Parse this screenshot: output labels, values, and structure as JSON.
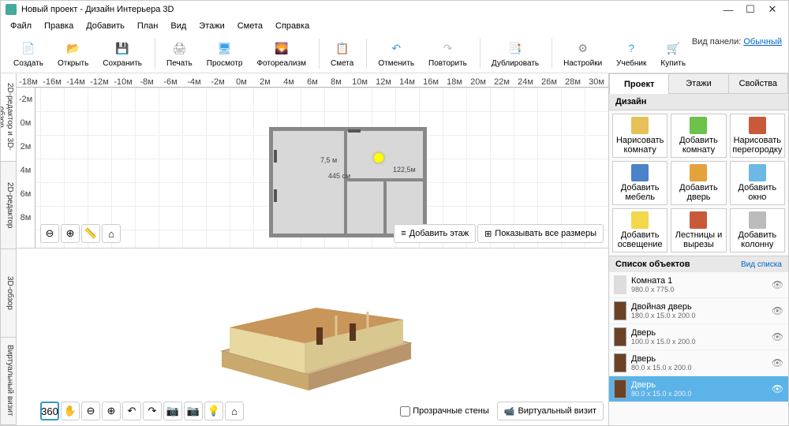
{
  "title": "Новый проект - Дизайн Интерьера 3D",
  "menus": [
    "Файл",
    "Правка",
    "Добавить",
    "План",
    "Вид",
    "Этажи",
    "Смета",
    "Справка"
  ],
  "panel_mode": {
    "label": "Вид панели:",
    "value": "Обычный"
  },
  "toolbar": [
    {
      "label": "Создать",
      "color": "#fff",
      "glyph": "📄"
    },
    {
      "label": "Открыть",
      "color": "#f5c04a",
      "glyph": "📂"
    },
    {
      "label": "Сохранить",
      "color": "#3b6fd1",
      "glyph": "💾"
    },
    {
      "sep": true
    },
    {
      "label": "Печать",
      "color": "#888",
      "glyph": "🖨"
    },
    {
      "label": "Просмотр",
      "color": "#3ba0e6",
      "glyph": "🖥"
    },
    {
      "label": "Фотореализм",
      "color": "#e08a3a",
      "glyph": "🌄"
    },
    {
      "sep": true
    },
    {
      "label": "Смета",
      "color": "#e08a3a",
      "glyph": "📋"
    },
    {
      "sep": true
    },
    {
      "label": "Отменить",
      "color": "#3ba0e6",
      "glyph": "↶"
    },
    {
      "label": "Повторить",
      "color": "#bbb",
      "glyph": "↷"
    },
    {
      "sep": true
    },
    {
      "label": "Дублировать",
      "color": "#3ba0e6",
      "glyph": "📑"
    },
    {
      "sep": true
    },
    {
      "label": "Настройки",
      "color": "#888",
      "glyph": "⚙"
    },
    {
      "label": "Учебник",
      "color": "#3ba0e6",
      "glyph": "?"
    },
    {
      "label": "Купить",
      "color": "#f5b400",
      "glyph": "🛒"
    }
  ],
  "left_tabs": [
    "2D-редактор и 3D-обзор",
    "2D-редактор",
    "3D-обзор",
    "Виртуальный визит"
  ],
  "ruler_h": [
    "-18м",
    "-16м",
    "-14м",
    "-12м",
    "-10м",
    "-8м",
    "-6м",
    "-4м",
    "-2м",
    "0м",
    "2м",
    "4м",
    "6м",
    "8м",
    "10м",
    "12м",
    "14м",
    "16м",
    "18м",
    "20м",
    "22м",
    "24м",
    "26м",
    "28м",
    "30м"
  ],
  "ruler_v": [
    "-2м",
    "0м",
    "2м",
    "4м",
    "6м",
    "8м"
  ],
  "plan_dims": {
    "d1": "7,5 м",
    "d2": "445 см",
    "d3": "122,5м"
  },
  "view2d_bar": {
    "zoom_out": "⊖",
    "zoom_in": "⊕",
    "ruler": "📏",
    "home": "⌂",
    "add_floor": "Добавить этаж",
    "show_dims": "Показывать все размеры"
  },
  "view3d_bar": {
    "rot": "360",
    "pan": "✋",
    "zoom_out": "⊖",
    "zoom_in": "⊕",
    "undo": "↶",
    "redo": "↷",
    "cam": "📷",
    "cam2": "📷",
    "light": "💡",
    "home": "⌂",
    "transparent": "Прозрачные стены",
    "virtual": "Виртуальный визит"
  },
  "right_tabs": [
    "Проект",
    "Этажи",
    "Свойства"
  ],
  "design_header": "Дизайн",
  "design_cells": [
    {
      "label": "Нарисовать комнату",
      "color": "#e6c15a"
    },
    {
      "label": "Добавить комнату",
      "color": "#6cc24a"
    },
    {
      "label": "Нарисовать перегородку",
      "color": "#c85a3a"
    },
    {
      "label": "Добавить мебель",
      "color": "#4a83c8"
    },
    {
      "label": "Добавить дверь",
      "color": "#e6a23a"
    },
    {
      "label": "Добавить окно",
      "color": "#6cb8e6"
    },
    {
      "label": "Добавить освещение",
      "color": "#f2d84a"
    },
    {
      "label": "Лестницы и вырезы",
      "color": "#c85a3a"
    },
    {
      "label": "Добавить колонну",
      "color": "#bcbcbc"
    }
  ],
  "objlist_header": "Список объектов",
  "objlist_view": "Вид списка",
  "objects": [
    {
      "name": "Комната 1",
      "dims": "980.0 x 775.0",
      "room": true
    },
    {
      "name": "Двойная дверь",
      "dims": "180.0 x 15.0 x 200.0"
    },
    {
      "name": "Дверь",
      "dims": "100.0 x 15.0 x 200.0"
    },
    {
      "name": "Дверь",
      "dims": "80.0 x 15.0 x 200.0"
    },
    {
      "name": "Дверь",
      "dims": "80.0 x 15.0 x 200.0",
      "sel": true
    }
  ]
}
